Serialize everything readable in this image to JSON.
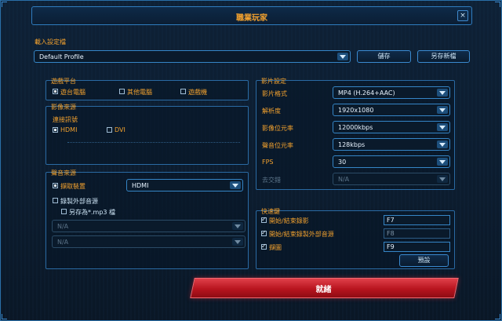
{
  "window": {
    "title": "職業玩家",
    "close_glyph": "×"
  },
  "profile": {
    "label": "載入設定檔",
    "value": "Default Profile",
    "save_label": "儲存",
    "save_as_label": "另存新檔"
  },
  "platform": {
    "title": "遊戲平台",
    "options": [
      {
        "label": "遊台電腦",
        "checked": true
      },
      {
        "label": "其他電腦",
        "checked": false
      },
      {
        "label": "遊戲機",
        "checked": false
      }
    ]
  },
  "video_source": {
    "title": "影像來源",
    "connection_label": "連接訊號",
    "options": [
      {
        "label": "HDMI",
        "checked": true
      },
      {
        "label": "DVI",
        "checked": false
      }
    ]
  },
  "audio_source": {
    "title": "聲音來源",
    "capture_label": "擷取裝置",
    "capture_value": "HDMI",
    "external_label": "錄製外部音源",
    "save_mp3_label": "另存為*.mp3 檔",
    "device1_value": "N/A",
    "device2_value": "N/A"
  },
  "video_settings": {
    "title": "影片設定",
    "rows": [
      {
        "label": "影片格式",
        "value": "MP4 (H.264+AAC)",
        "disabled": false
      },
      {
        "label": "解析度",
        "value": "1920x1080",
        "disabled": false
      },
      {
        "label": "影像位元率",
        "value": "12000kbps",
        "disabled": false
      },
      {
        "label": "聲音位元率",
        "value": "128kbps",
        "disabled": false
      },
      {
        "label": "FPS",
        "value": "30",
        "disabled": false
      },
      {
        "label": "去交錯",
        "value": "N/A",
        "disabled": true
      }
    ]
  },
  "hotkeys": {
    "title": "快速鍵",
    "rows": [
      {
        "label": "開始/結束錄影",
        "key": "F7",
        "checked": true
      },
      {
        "label": "開始/結束錄製外部音源",
        "key": "F8",
        "checked": true
      },
      {
        "label": "擷圖",
        "key": "F9",
        "checked": true
      }
    ],
    "default_label": "預設"
  },
  "ready_label": "就緒"
}
